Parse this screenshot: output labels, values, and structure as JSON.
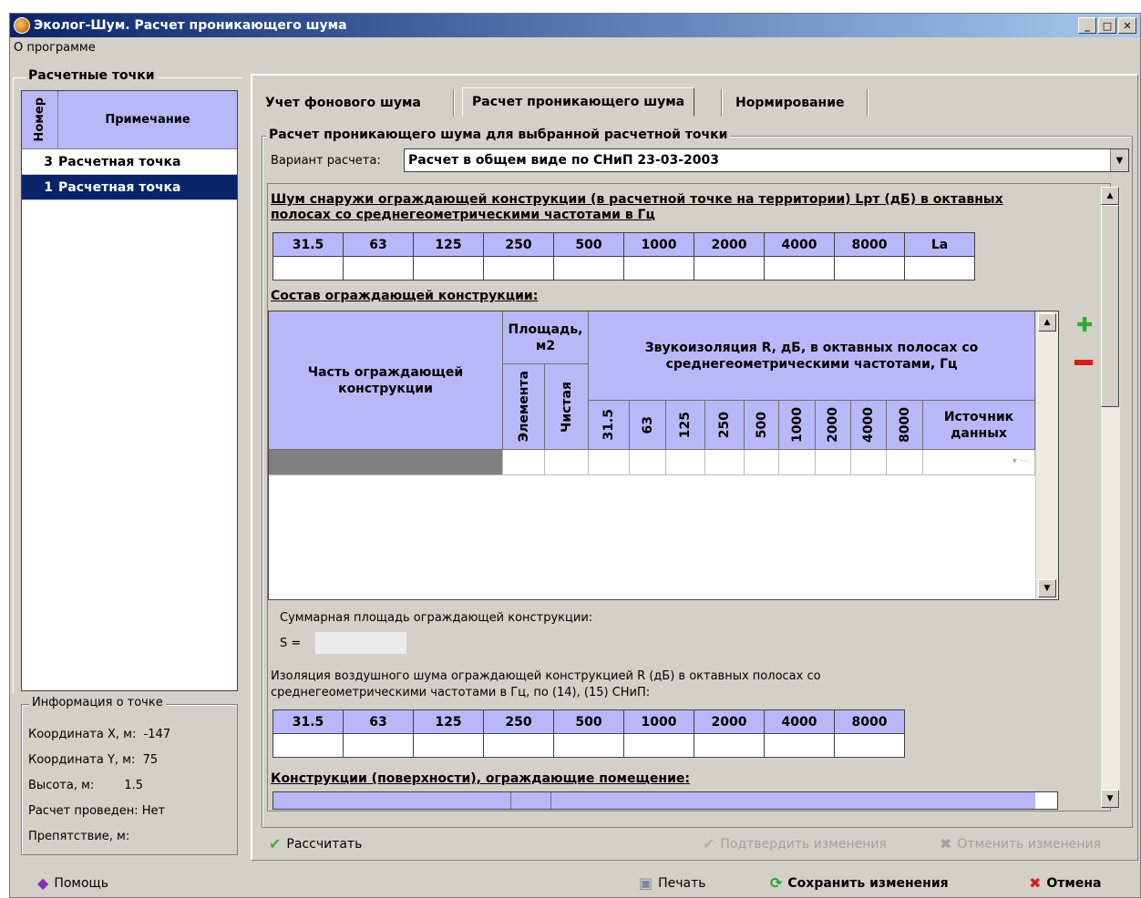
{
  "window": {
    "title": "Эколог-Шум. Расчет проникающего шума",
    "min": "_",
    "max": "□",
    "close": "✕"
  },
  "menu": {
    "about": "О программе"
  },
  "points": {
    "legend": "Расчетные точки",
    "col_num": "Номер",
    "col_note": "Примечание",
    "rows": [
      {
        "num": "3",
        "note": "Расчетная точка",
        "selected": false
      },
      {
        "num": "1",
        "note": "Расчетная точка",
        "selected": true
      }
    ]
  },
  "info": {
    "legend": "Информация о точке",
    "x_label": "Координата X, м:",
    "x_value": "-147",
    "y_label": "Координата Y, м:",
    "y_value": "75",
    "h_label": "Высота, м:",
    "h_value": "1.5",
    "done_label": "Расчет проведен:",
    "done_value": "Нет",
    "obst_label": "Препятствие, м:"
  },
  "tabs": [
    "Учет фонового шума",
    "Расчет проникающего шума",
    "Нормирование"
  ],
  "main": {
    "group_title": "Расчет проникающего шума для выбранной расчетной точки",
    "variant_label": "Вариант расчета:",
    "variant_value": "Расчет в общем виде по СНиП 23-03-2003",
    "outside_label_1": "Шум снаружи ограждающей конструкции (в расчетной точке на территории) Lрт (дБ) в октавных",
    "outside_label_2": "полосах со среднегеометрическими частотами в Гц",
    "freqs_la": [
      "31.5",
      "63",
      "125",
      "250",
      "500",
      "1000",
      "2000",
      "4000",
      "8000",
      "La"
    ],
    "composition_label": "Состав ограждающей конструкции:",
    "grid": {
      "part": "Часть ограждающей конструкции",
      "area": "Площадь, м2",
      "area_el": "Элемента",
      "area_clean": "Чистая",
      "iso": "Звукоизоляция R, дБ, в октавных полосах со среднегеометрическими частотами, Гц",
      "freqs": [
        "31.5",
        "63",
        "125",
        "250",
        "500",
        "1000",
        "2000",
        "4000",
        "8000"
      ],
      "source": "Источник данных"
    },
    "sum_label": "Суммарная площадь ограждающей конструкции:",
    "s_label": "S =",
    "isolation_1": "Изоляция воздушного шума ограждающей конструкцией R (дБ) в октавных полосах со",
    "isolation_2": "среднегеометрическими частотами в Гц, по (14), (15) СНиП:",
    "freqs9": [
      "31.5",
      "63",
      "125",
      "250",
      "500",
      "1000",
      "2000",
      "4000",
      "8000"
    ],
    "constructions_label": "Конструкции (поверхности), ограждающие помещение:"
  },
  "actions": {
    "calc": "Рассчитать",
    "confirm": "Подтвердить изменения",
    "undo": "Отменить изменения"
  },
  "bottom": {
    "help": "Помощь",
    "print": "Печать",
    "save": "Сохранить изменения",
    "cancel": "Отмена"
  }
}
